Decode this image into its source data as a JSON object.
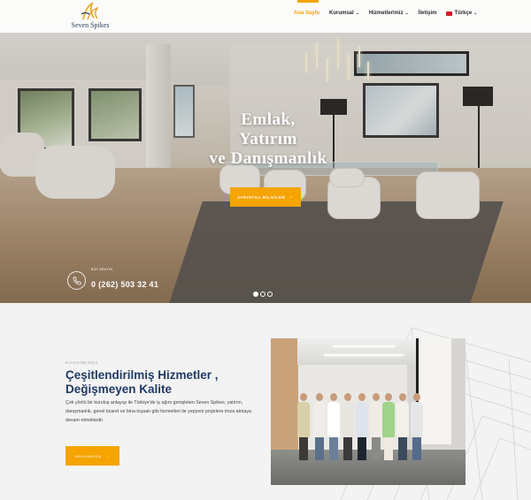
{
  "brand": {
    "logo_text": "Seven Spikes"
  },
  "nav": {
    "items": [
      {
        "label": "Ana Sayfa",
        "active": true,
        "has_dropdown": false
      },
      {
        "label": "Kurumsal",
        "active": false,
        "has_dropdown": true
      },
      {
        "label": "Hizmetlerimiz",
        "active": false,
        "has_dropdown": true
      },
      {
        "label": "İletişim",
        "active": false,
        "has_dropdown": false
      }
    ],
    "language": {
      "label": "Türkçe",
      "flag": "turkey-flag-icon"
    }
  },
  "hero": {
    "title_lines": [
      "Emlak,",
      "Yatırım",
      "ve Danışmanlık"
    ],
    "button_label": "AYRINTILI BİLGİLER",
    "phone_caption": "BİZİ ARAYIN",
    "phone_number": "0 (262) 503 32 41",
    "slides_total": 3,
    "active_slide": 1
  },
  "about": {
    "eyebrow": "HAKKIMIZDA",
    "title_line1": "Çeşitlendirilmiş Hizmetler ,",
    "title_line2": "Değişmeyen Kalite",
    "text": "Çok yönlü bir kuruluş anlayışı ile Türkiye'de iş ağını genişleten Seven Spikes; yatırım, danışmanlık, genel ticaret ve bina inşaatı gibi hizmetleri ile yepyeni projelere imza atmaya devam etmektedir.",
    "button_label": "HAKKIMIZDA"
  },
  "colors": {
    "accent": "#f5a400",
    "heading": "#203a64"
  }
}
